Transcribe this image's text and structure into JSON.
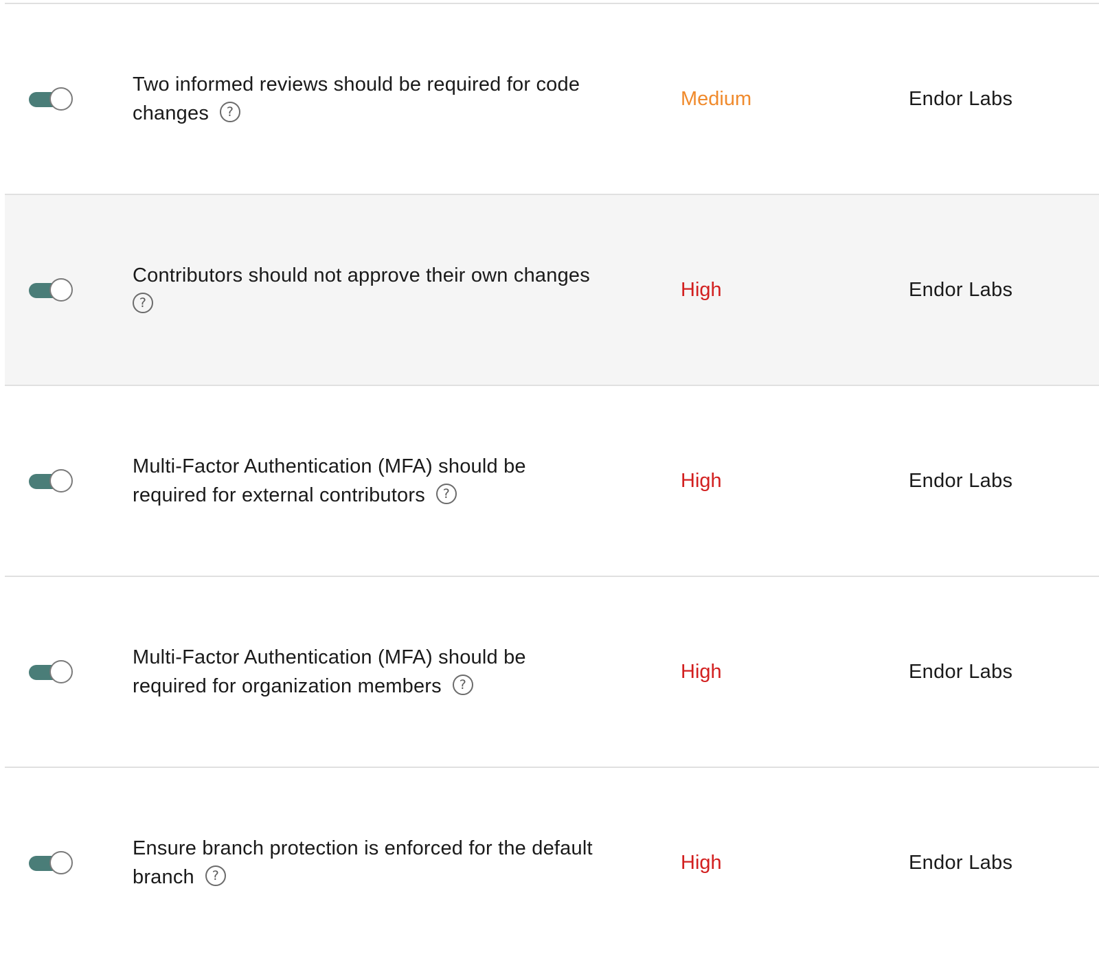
{
  "colors": {
    "toggle_on": "#4a7d78",
    "severity_medium": "#f08a2c",
    "severity_high": "#d21f1f",
    "row_alt_bg": "#f5f5f5",
    "border": "#e0e0e0"
  },
  "policies": [
    {
      "enabled": true,
      "description": "Two informed reviews should be required for code changes",
      "help_icon": "question-circle-icon",
      "severity": "Medium",
      "source": "Endor Labs"
    },
    {
      "enabled": true,
      "description": "Contributors should not approve their own changes",
      "help_icon": "question-circle-icon",
      "severity": "High",
      "source": "Endor Labs"
    },
    {
      "enabled": true,
      "description": "Multi-Factor Authentication (MFA) should be required for external contributors",
      "help_icon": "question-circle-icon",
      "severity": "High",
      "source": "Endor Labs"
    },
    {
      "enabled": true,
      "description": "Multi-Factor Authentication (MFA) should be required for organization members",
      "help_icon": "question-circle-icon",
      "severity": "High",
      "source": "Endor Labs"
    },
    {
      "enabled": true,
      "description": "Ensure branch protection is enforced for the default branch",
      "help_icon": "question-circle-icon",
      "severity": "High",
      "source": "Endor Labs"
    }
  ],
  "help_glyph": "?"
}
